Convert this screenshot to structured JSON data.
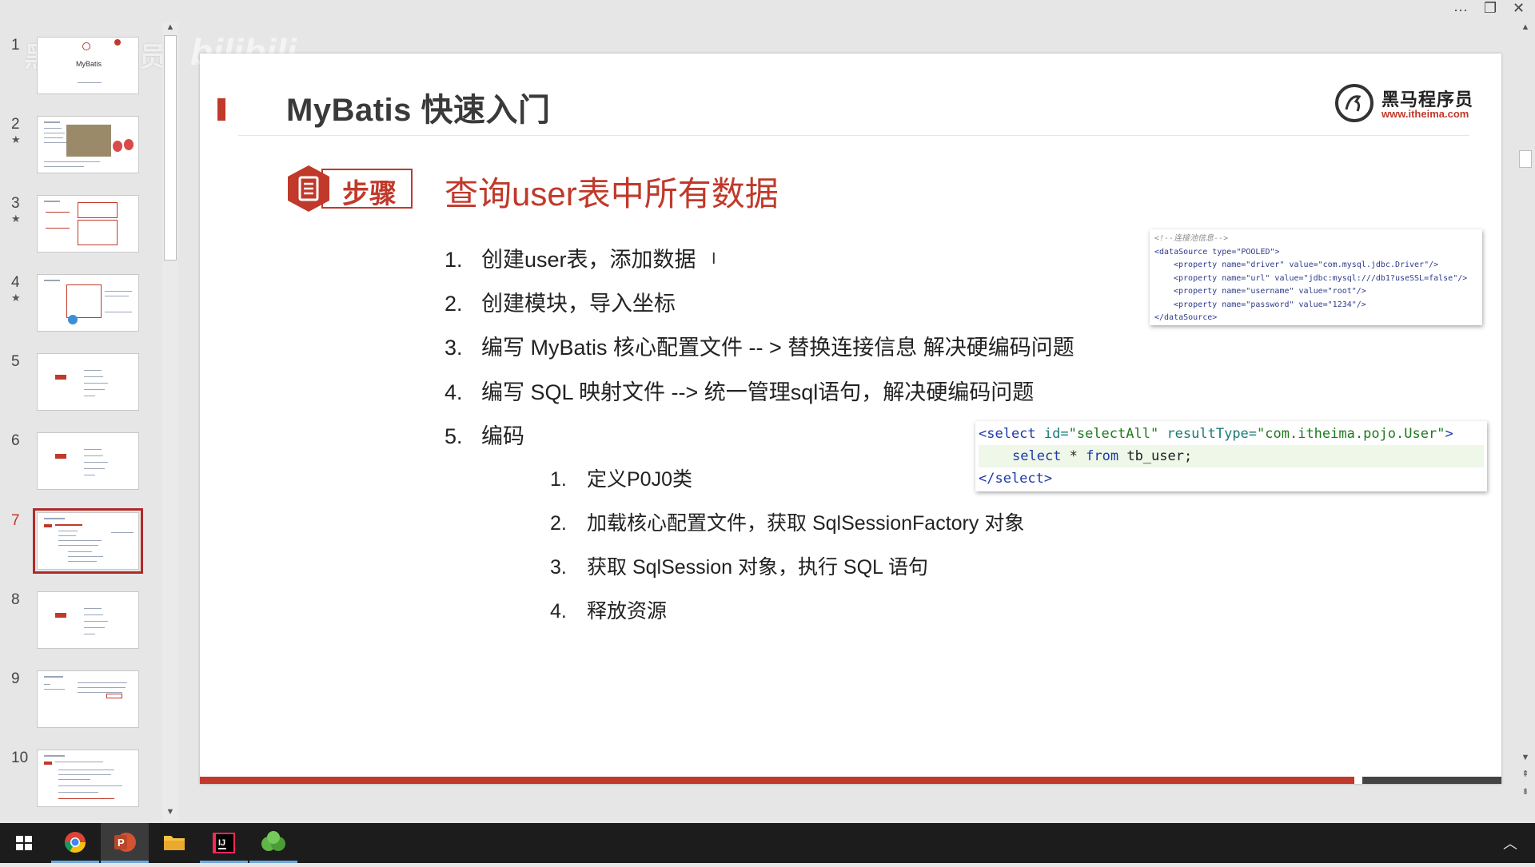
{
  "window": {
    "more_label": "···",
    "restore_label": "❐",
    "close_label": "✕"
  },
  "thumbnails": [
    {
      "num": "1",
      "star": "",
      "title": "MyBatis",
      "active": false
    },
    {
      "num": "2",
      "star": "★",
      "active": false
    },
    {
      "num": "3",
      "star": "★",
      "active": false
    },
    {
      "num": "4",
      "star": "★",
      "active": false
    },
    {
      "num": "5",
      "star": "",
      "active": false
    },
    {
      "num": "6",
      "star": "",
      "active": false
    },
    {
      "num": "7",
      "star": "",
      "active": true
    },
    {
      "num": "8",
      "star": "",
      "active": false
    },
    {
      "num": "9",
      "star": "",
      "active": false
    },
    {
      "num": "10",
      "star": "",
      "active": false
    }
  ],
  "watermark": {
    "text1": "黑马程序员",
    "text2": "bilibili"
  },
  "slide": {
    "title": "MyBatis 快速入门",
    "logo_name": "黑马程序员",
    "logo_url": "www.itheima.com",
    "step_label": "步骤",
    "heading": "查询user表中所有数据",
    "items": [
      {
        "num": "1.",
        "text": "创建user表，添加数据"
      },
      {
        "num": "2.",
        "text": "创建模块，导入坐标"
      },
      {
        "num": "3.",
        "text": "编写 MyBatis 核心配置文件  -- > 替换连接信息 解决硬编码问题"
      },
      {
        "num": "4.",
        "text": "编写 SQL 映射文件 --> 统一管理sql语句，解决硬编码问题"
      },
      {
        "num": "5.",
        "text": "编码"
      }
    ],
    "subitems": [
      {
        "num": "1.",
        "text": "定义P0J0类"
      },
      {
        "num": "2.",
        "text": "加载核心配置文件，获取 SqlSessionFactory 对象"
      },
      {
        "num": "3.",
        "text": "获取 SqlSession 对象，执行 SQL 语句"
      },
      {
        "num": "4.",
        "text": "释放资源"
      }
    ],
    "cursor": "I",
    "code1": {
      "comment": "<!--连接池信息-->",
      "open": "<dataSource type=\"POOLED\">",
      "p1": "<property name=\"driver\" value=\"com.mysql.jdbc.Driver\"/>",
      "p2": "<property name=\"url\" value=\"jdbc:mysql:///db1?useSSL=false\"/>",
      "p3": "<property name=\"username\" value=\"root\"/>",
      "p4": "<property name=\"password\" value=\"1234\"/>",
      "close": "</dataSource>"
    },
    "code2": {
      "open_tag": "<select",
      "id_attr": " id=",
      "id_val": "\"selectAll\"",
      "rt_attr": "   resultType=",
      "rt_val": "\"com.itheima.pojo.User\"",
      "end": ">",
      "kw_select": "select",
      "star": " * ",
      "kw_from": "from",
      "table": " tb_user;",
      "close": "</select>"
    }
  },
  "taskbar": {
    "apps": [
      "start-icon",
      "chrome-icon",
      "powerpoint-icon",
      "file-explorer-icon",
      "intellij-icon",
      "green-app-icon"
    ],
    "tray_label": "︿"
  }
}
